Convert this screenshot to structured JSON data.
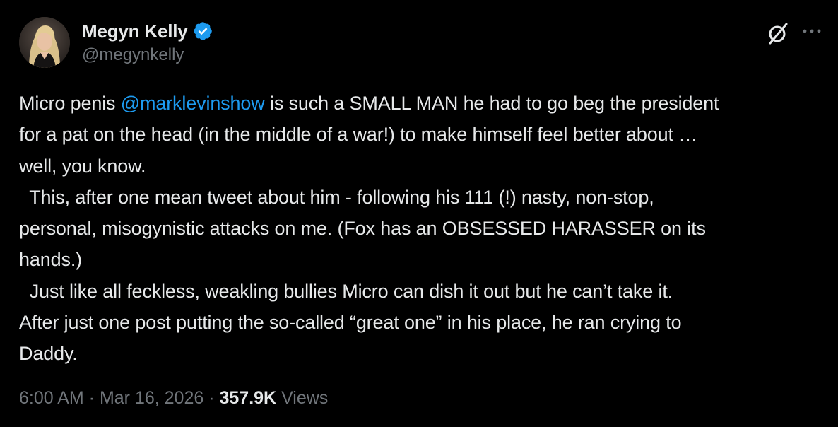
{
  "author": {
    "display_name": "Megyn Kelly",
    "handle": "@megynkelly",
    "verified": true,
    "verified_color": "#1d9bf0"
  },
  "icons": {
    "grok": "grok-icon",
    "more": "more-horizontal-icon",
    "verified": "verified-badge-icon"
  },
  "tweet": {
    "lines": [
      {
        "segments": [
          {
            "text": "Micro penis ",
            "type": "text"
          },
          {
            "text": "@marklevinshow",
            "type": "mention"
          },
          {
            "text": " is such a SMALL MAN he had to go beg the president",
            "type": "text"
          }
        ]
      },
      {
        "segments": [
          {
            "text": "for a pat on the head (in the middle of a war!) to make himself feel better about …",
            "type": "text"
          }
        ]
      },
      {
        "segments": [
          {
            "text": "well, you know.",
            "type": "text"
          }
        ]
      },
      {
        "segments": [
          {
            "text": "  This, after one mean tweet about him - following his 111 (!) nasty, non-stop,",
            "type": "text"
          }
        ]
      },
      {
        "segments": [
          {
            "text": "personal, misogynistic attacks on me. (Fox has an OBSESSED HARASSER on its",
            "type": "text"
          }
        ]
      },
      {
        "segments": [
          {
            "text": "hands.)",
            "type": "text"
          }
        ]
      },
      {
        "segments": [
          {
            "text": "  Just like all feckless, weakling bullies Micro can dish it out but he can’t take it.",
            "type": "text"
          }
        ]
      },
      {
        "segments": [
          {
            "text": "After just one post putting the so-called “great one” in his place, he ran crying to",
            "type": "text"
          }
        ]
      },
      {
        "segments": [
          {
            "text": "Daddy.",
            "type": "text"
          }
        ]
      }
    ],
    "mention_color": "#1d9bf0"
  },
  "meta": {
    "time": "6:00 AM",
    "separator": " · ",
    "date": "Mar 16, 2026",
    "views_count": "357.9K",
    "views_label": " Views"
  }
}
